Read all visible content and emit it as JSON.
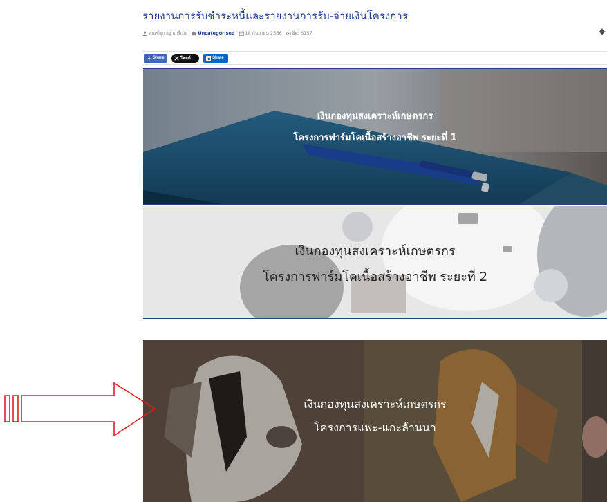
{
  "post": {
    "title": "รายงานการรับชำระหนี้และรายงานการรับ-จ่ายเงินโครงการ",
    "meta": {
      "author": "คณฑ์ฐุกาญ ธารีเม็ด",
      "category": "Uncategorised",
      "date": "18 กันยายน 2566",
      "hits": "ฮิต: 6157"
    }
  },
  "share": {
    "facebook_label": "Share",
    "x_label": "โพสต์",
    "linkedin_label": "Share"
  },
  "banners": [
    {
      "line1": "เงินกองทุนสงเคราะห์เกษตรกร",
      "line2": "โครงการฟาร์มโคเนื้อสร้างอาชีพ ระยะที่ 1"
    },
    {
      "line1": "เงินกองทุนสงเคราะห์เกษตรกร",
      "line2": "โครงการฟาร์มโคเนื้อสร้างอาชีพ ระยะที่ 2"
    },
    {
      "line1": "เงินกองทุนสงเคราะห์เกษตรกร",
      "line2": "โครงการแพะ-แกะล้านนา"
    }
  ],
  "colors": {
    "title": "#1a3a8f",
    "annotation": "#e02020",
    "banner_border": "#2a3f85"
  }
}
